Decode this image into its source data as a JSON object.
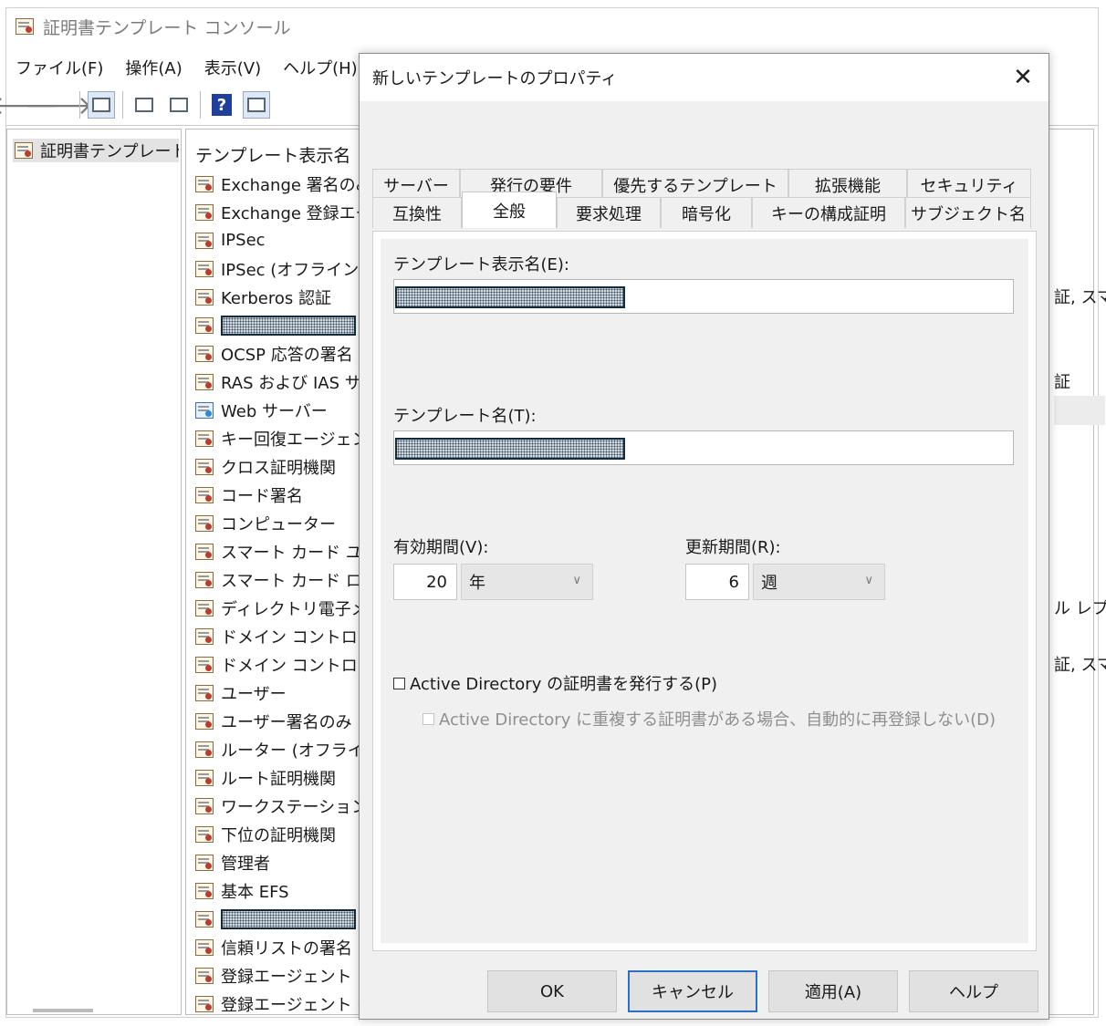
{
  "console": {
    "title": "証明書テンプレート コンソール",
    "menu": [
      "ファイル(F)",
      "操作(A)",
      "表示(V)",
      "ヘルプ(H)"
    ],
    "tree_root": "証明書テンプレート (",
    "list_header": "テンプレート表示名",
    "items": [
      {
        "label": "Exchange 署名のみ",
        "redacted": false,
        "icon": "certificate-icon"
      },
      {
        "label": "Exchange 登録エー",
        "redacted": false,
        "icon": "certificate-icon"
      },
      {
        "label": "IPSec",
        "redacted": false,
        "icon": "certificate-icon"
      },
      {
        "label": "IPSec (オフライン要求",
        "redacted": false,
        "icon": "certificate-icon"
      },
      {
        "label": "Kerberos 認証",
        "redacted": false,
        "icon": "certificate-icon"
      },
      {
        "label": "",
        "redacted": true,
        "icon": "certificate-icon"
      },
      {
        "label": "OCSP 応答の署名",
        "redacted": false,
        "icon": "certificate-icon"
      },
      {
        "label": "RAS および IAS サー/",
        "redacted": false,
        "icon": "certificate-icon"
      },
      {
        "label": "Web サーバー",
        "redacted": false,
        "icon": "web-certificate-icon"
      },
      {
        "label": "キー回復エージェント",
        "redacted": false,
        "icon": "certificate-icon"
      },
      {
        "label": "クロス証明機関",
        "redacted": false,
        "icon": "certificate-icon"
      },
      {
        "label": "コード署名",
        "redacted": false,
        "icon": "certificate-icon"
      },
      {
        "label": "コンピューター",
        "redacted": false,
        "icon": "certificate-icon"
      },
      {
        "label": "スマート カード ユーザー",
        "redacted": false,
        "icon": "certificate-icon"
      },
      {
        "label": "スマート カード ログオン",
        "redacted": false,
        "icon": "certificate-icon"
      },
      {
        "label": "ディレクトリ電子メール",
        "redacted": false,
        "icon": "certificate-icon"
      },
      {
        "label": "ドメイン コントローラー",
        "redacted": false,
        "icon": "certificate-icon"
      },
      {
        "label": "ドメイン コントローラー(",
        "redacted": false,
        "icon": "certificate-icon"
      },
      {
        "label": "ユーザー",
        "redacted": false,
        "icon": "certificate-icon"
      },
      {
        "label": "ユーザー署名のみ",
        "redacted": false,
        "icon": "certificate-icon"
      },
      {
        "label": "ルーター (オフライン要",
        "redacted": false,
        "icon": "certificate-icon"
      },
      {
        "label": "ルート証明機関",
        "redacted": false,
        "icon": "certificate-icon"
      },
      {
        "label": "ワークステーション認証",
        "redacted": false,
        "icon": "certificate-icon"
      },
      {
        "label": "下位の証明機関",
        "redacted": false,
        "icon": "certificate-icon"
      },
      {
        "label": "管理者",
        "redacted": false,
        "icon": "certificate-icon"
      },
      {
        "label": "基本 EFS",
        "redacted": false,
        "icon": "certificate-icon"
      },
      {
        "label": "",
        "redacted": true,
        "icon": "certificate-icon"
      },
      {
        "label": "信頼リストの署名",
        "redacted": false,
        "icon": "certificate-icon"
      },
      {
        "label": "登録エージェント",
        "redacted": false,
        "icon": "certificate-icon"
      },
      {
        "label": "登録エージェント (コン",
        "redacted": false,
        "icon": "certificate-icon"
      }
    ],
    "right_column_fragments": [
      "証, スマ",
      "証",
      "ル レプ",
      "証, スマ"
    ]
  },
  "dialog": {
    "title": "新しいテンプレートのプロパティ",
    "close_icon": "close-icon",
    "tabs_back": [
      "サーバー",
      "発行の要件",
      "優先するテンプレート",
      "拡張機能",
      "セキュリティ"
    ],
    "tabs_front": [
      "互換性",
      "全般",
      "要求処理",
      "暗号化",
      "キーの構成証明",
      "サブジェクト名"
    ],
    "active_tab": "全般",
    "display_name_label": "テンプレート表示名(E):",
    "template_name_label": "テンプレート名(T):",
    "validity_label": "有効期間(V):",
    "validity_value": "20",
    "validity_unit": "年",
    "renewal_label": "更新期間(R):",
    "renewal_value": "6",
    "renewal_unit": "週",
    "publish_ad_label": "Active Directory の証明書を発行する(P)",
    "publish_ad_checked": false,
    "no_reenroll_label": "Active Directory に重複する証明書がある場合、自動的に再登録しない(D)",
    "no_reenroll_checked": false,
    "buttons": {
      "ok": "OK",
      "cancel": "キャンセル",
      "apply": "適用(A)",
      "help": "ヘルプ"
    }
  }
}
